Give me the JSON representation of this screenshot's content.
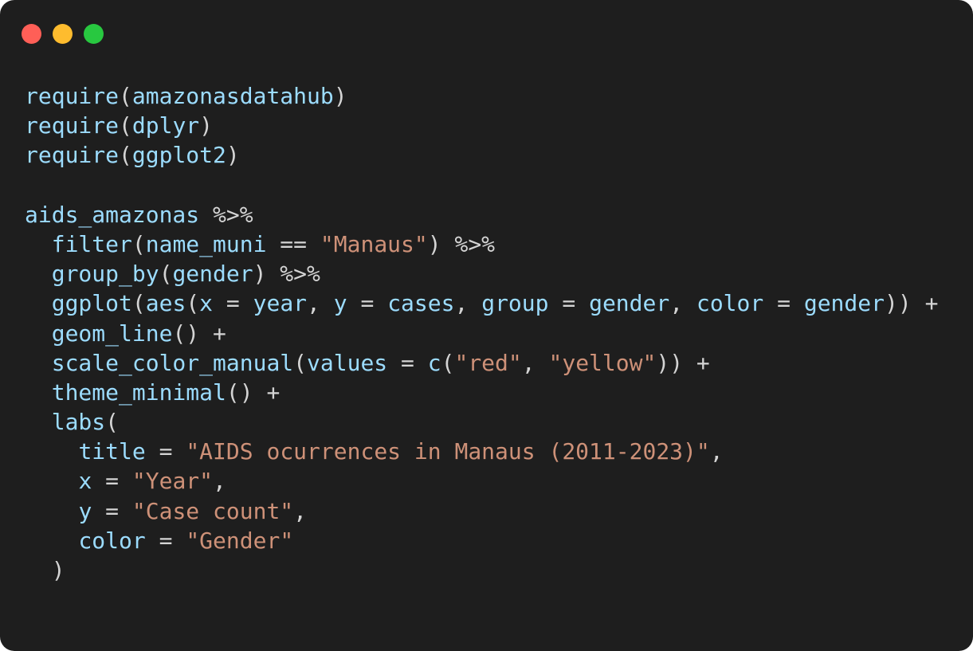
{
  "window": {
    "controls": [
      {
        "name": "close",
        "color": "#ff5f57"
      },
      {
        "name": "minimize",
        "color": "#febc2e"
      },
      {
        "name": "maximize",
        "color": "#28c840"
      }
    ]
  },
  "colors": {
    "background": "#1e1e1e",
    "identifier": "#9cdcfe",
    "string": "#ce9178",
    "operator": "#d4d4d4"
  },
  "code": {
    "lines": [
      [
        {
          "t": "fn",
          "v": "require"
        },
        {
          "t": "op",
          "v": "("
        },
        {
          "t": "fn",
          "v": "amazonasdatahub"
        },
        {
          "t": "op",
          "v": ")"
        }
      ],
      [
        {
          "t": "fn",
          "v": "require"
        },
        {
          "t": "op",
          "v": "("
        },
        {
          "t": "fn",
          "v": "dplyr"
        },
        {
          "t": "op",
          "v": ")"
        }
      ],
      [
        {
          "t": "fn",
          "v": "require"
        },
        {
          "t": "op",
          "v": "("
        },
        {
          "t": "fn",
          "v": "ggplot2"
        },
        {
          "t": "op",
          "v": ")"
        }
      ],
      [],
      [
        {
          "t": "fn",
          "v": "aids_amazonas"
        },
        {
          "t": "op",
          "v": " %>%"
        }
      ],
      [
        {
          "t": "op",
          "v": "  "
        },
        {
          "t": "fn",
          "v": "filter"
        },
        {
          "t": "op",
          "v": "("
        },
        {
          "t": "fn",
          "v": "name_muni"
        },
        {
          "t": "op",
          "v": " == "
        },
        {
          "t": "str",
          "v": "\"Manaus\""
        },
        {
          "t": "op",
          "v": ") %>%"
        }
      ],
      [
        {
          "t": "op",
          "v": "  "
        },
        {
          "t": "fn",
          "v": "group_by"
        },
        {
          "t": "op",
          "v": "("
        },
        {
          "t": "fn",
          "v": "gender"
        },
        {
          "t": "op",
          "v": ") %>%"
        }
      ],
      [
        {
          "t": "op",
          "v": "  "
        },
        {
          "t": "fn",
          "v": "ggplot"
        },
        {
          "t": "op",
          "v": "("
        },
        {
          "t": "fn",
          "v": "aes"
        },
        {
          "t": "op",
          "v": "("
        },
        {
          "t": "fn",
          "v": "x"
        },
        {
          "t": "op",
          "v": " = "
        },
        {
          "t": "fn",
          "v": "year"
        },
        {
          "t": "op",
          "v": ", "
        },
        {
          "t": "fn",
          "v": "y"
        },
        {
          "t": "op",
          "v": " = "
        },
        {
          "t": "fn",
          "v": "cases"
        },
        {
          "t": "op",
          "v": ", "
        },
        {
          "t": "fn",
          "v": "group"
        },
        {
          "t": "op",
          "v": " = "
        },
        {
          "t": "fn",
          "v": "gender"
        },
        {
          "t": "op",
          "v": ", "
        },
        {
          "t": "fn",
          "v": "color"
        },
        {
          "t": "op",
          "v": " = "
        },
        {
          "t": "fn",
          "v": "gender"
        },
        {
          "t": "op",
          "v": ")) +"
        }
      ],
      [
        {
          "t": "op",
          "v": "  "
        },
        {
          "t": "fn",
          "v": "geom_line"
        },
        {
          "t": "op",
          "v": "() +"
        }
      ],
      [
        {
          "t": "op",
          "v": "  "
        },
        {
          "t": "fn",
          "v": "scale_color_manual"
        },
        {
          "t": "op",
          "v": "("
        },
        {
          "t": "fn",
          "v": "values"
        },
        {
          "t": "op",
          "v": " = "
        },
        {
          "t": "fn",
          "v": "c"
        },
        {
          "t": "op",
          "v": "("
        },
        {
          "t": "str",
          "v": "\"red\""
        },
        {
          "t": "op",
          "v": ", "
        },
        {
          "t": "str",
          "v": "\"yellow\""
        },
        {
          "t": "op",
          "v": ")) +"
        }
      ],
      [
        {
          "t": "op",
          "v": "  "
        },
        {
          "t": "fn",
          "v": "theme_minimal"
        },
        {
          "t": "op",
          "v": "() +"
        }
      ],
      [
        {
          "t": "op",
          "v": "  "
        },
        {
          "t": "fn",
          "v": "labs"
        },
        {
          "t": "op",
          "v": "("
        }
      ],
      [
        {
          "t": "op",
          "v": "    "
        },
        {
          "t": "fn",
          "v": "title"
        },
        {
          "t": "op",
          "v": " = "
        },
        {
          "t": "str",
          "v": "\"AIDS ocurrences in Manaus (2011-2023)\""
        },
        {
          "t": "op",
          "v": ","
        }
      ],
      [
        {
          "t": "op",
          "v": "    "
        },
        {
          "t": "fn",
          "v": "x"
        },
        {
          "t": "op",
          "v": " = "
        },
        {
          "t": "str",
          "v": "\"Year\""
        },
        {
          "t": "op",
          "v": ","
        }
      ],
      [
        {
          "t": "op",
          "v": "    "
        },
        {
          "t": "fn",
          "v": "y"
        },
        {
          "t": "op",
          "v": " = "
        },
        {
          "t": "str",
          "v": "\"Case count\""
        },
        {
          "t": "op",
          "v": ","
        }
      ],
      [
        {
          "t": "op",
          "v": "    "
        },
        {
          "t": "fn",
          "v": "color"
        },
        {
          "t": "op",
          "v": " = "
        },
        {
          "t": "str",
          "v": "\"Gender\""
        }
      ],
      [
        {
          "t": "op",
          "v": "  )"
        }
      ]
    ]
  }
}
